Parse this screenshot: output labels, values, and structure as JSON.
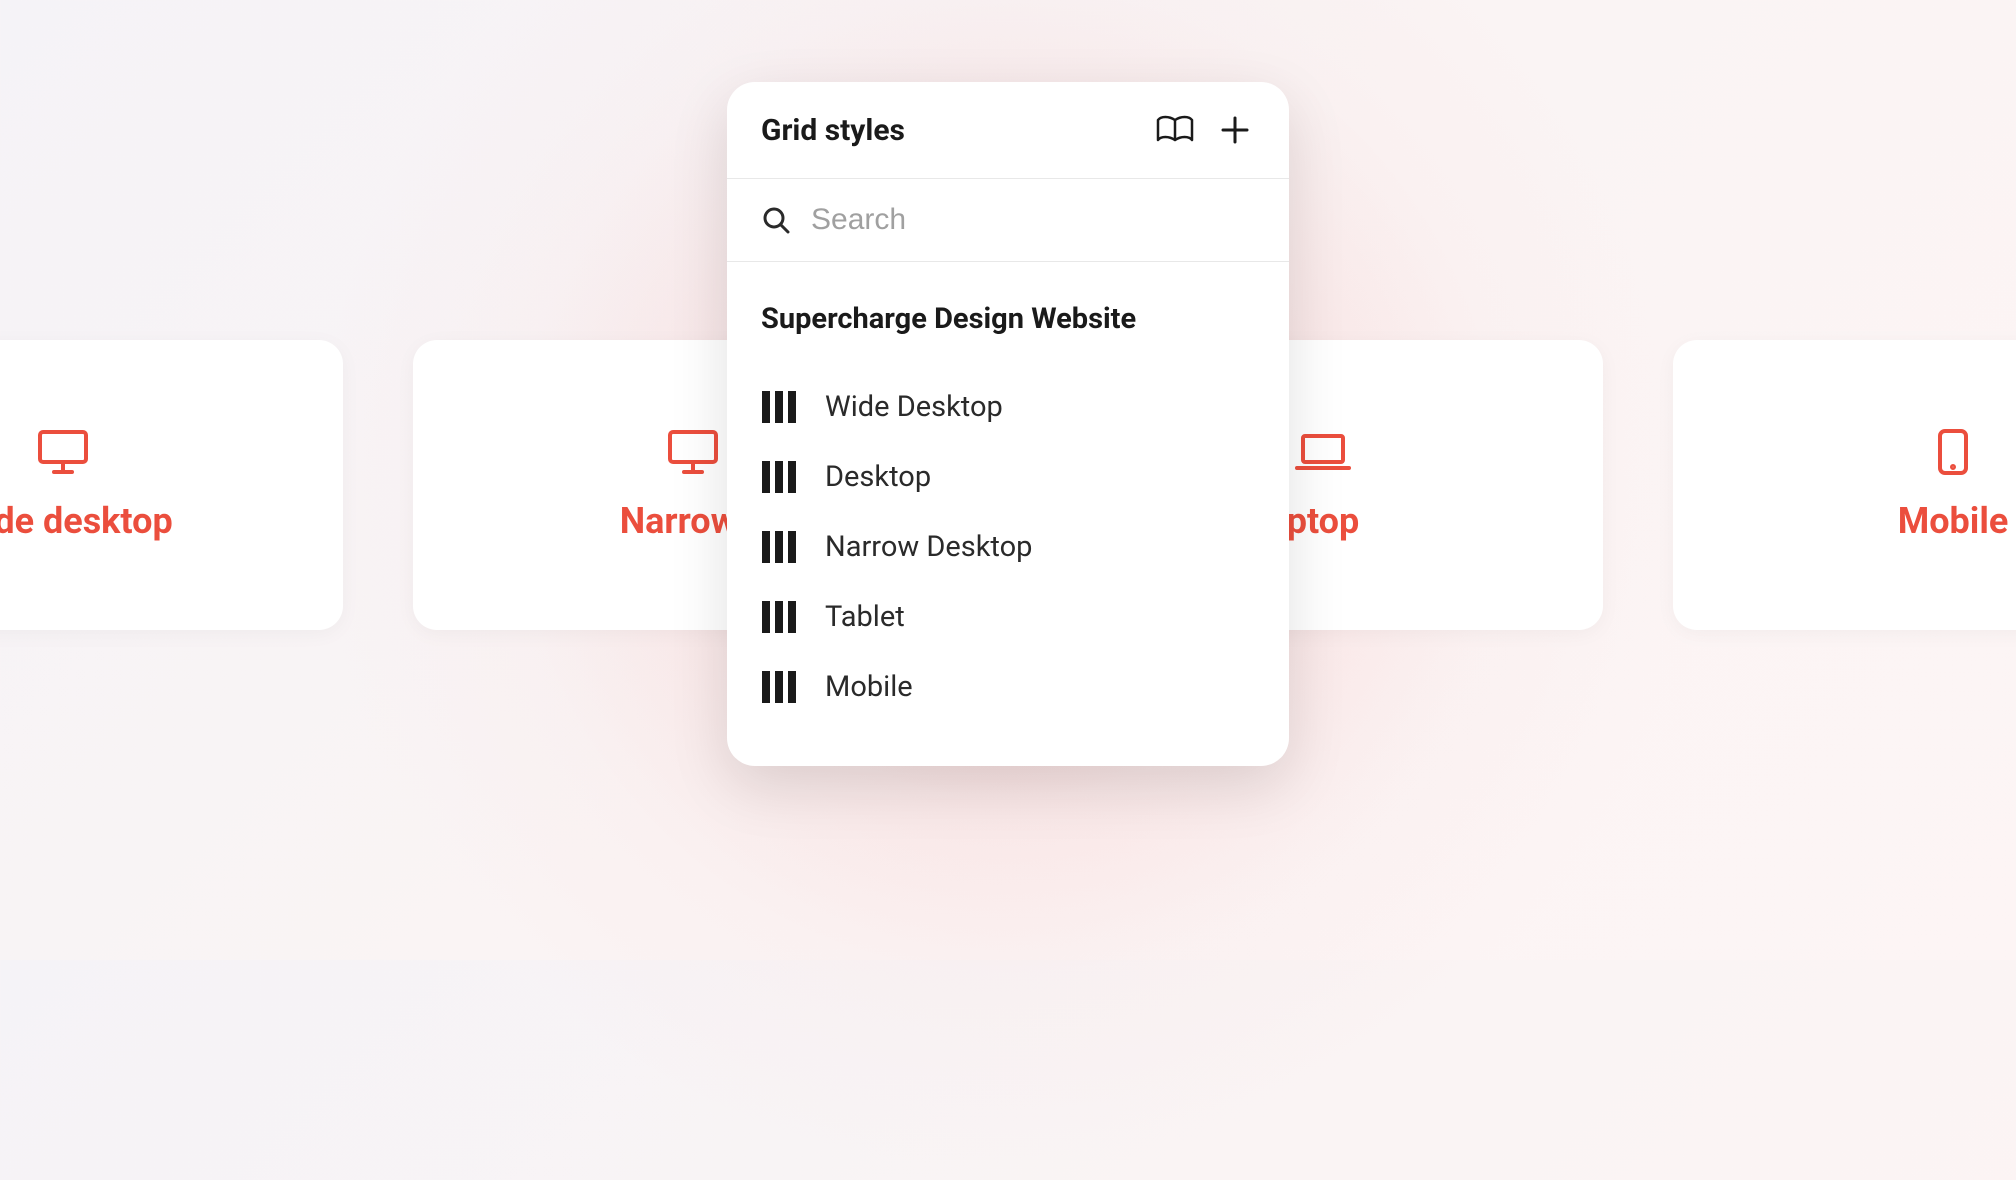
{
  "panel": {
    "title": "Grid styles",
    "search_placeholder": "Search",
    "group_title": "Supercharge Design Website",
    "styles": [
      {
        "label": "Wide Desktop"
      },
      {
        "label": "Desktop"
      },
      {
        "label": "Narrow Desktop"
      },
      {
        "label": "Tablet"
      },
      {
        "label": "Mobile"
      }
    ]
  },
  "cards": {
    "wide": {
      "label": "Wide desktop"
    },
    "narrow": {
      "label": "Narrow d"
    },
    "laptop": {
      "label": "ptop"
    },
    "mobile": {
      "label": "Mobile"
    }
  }
}
